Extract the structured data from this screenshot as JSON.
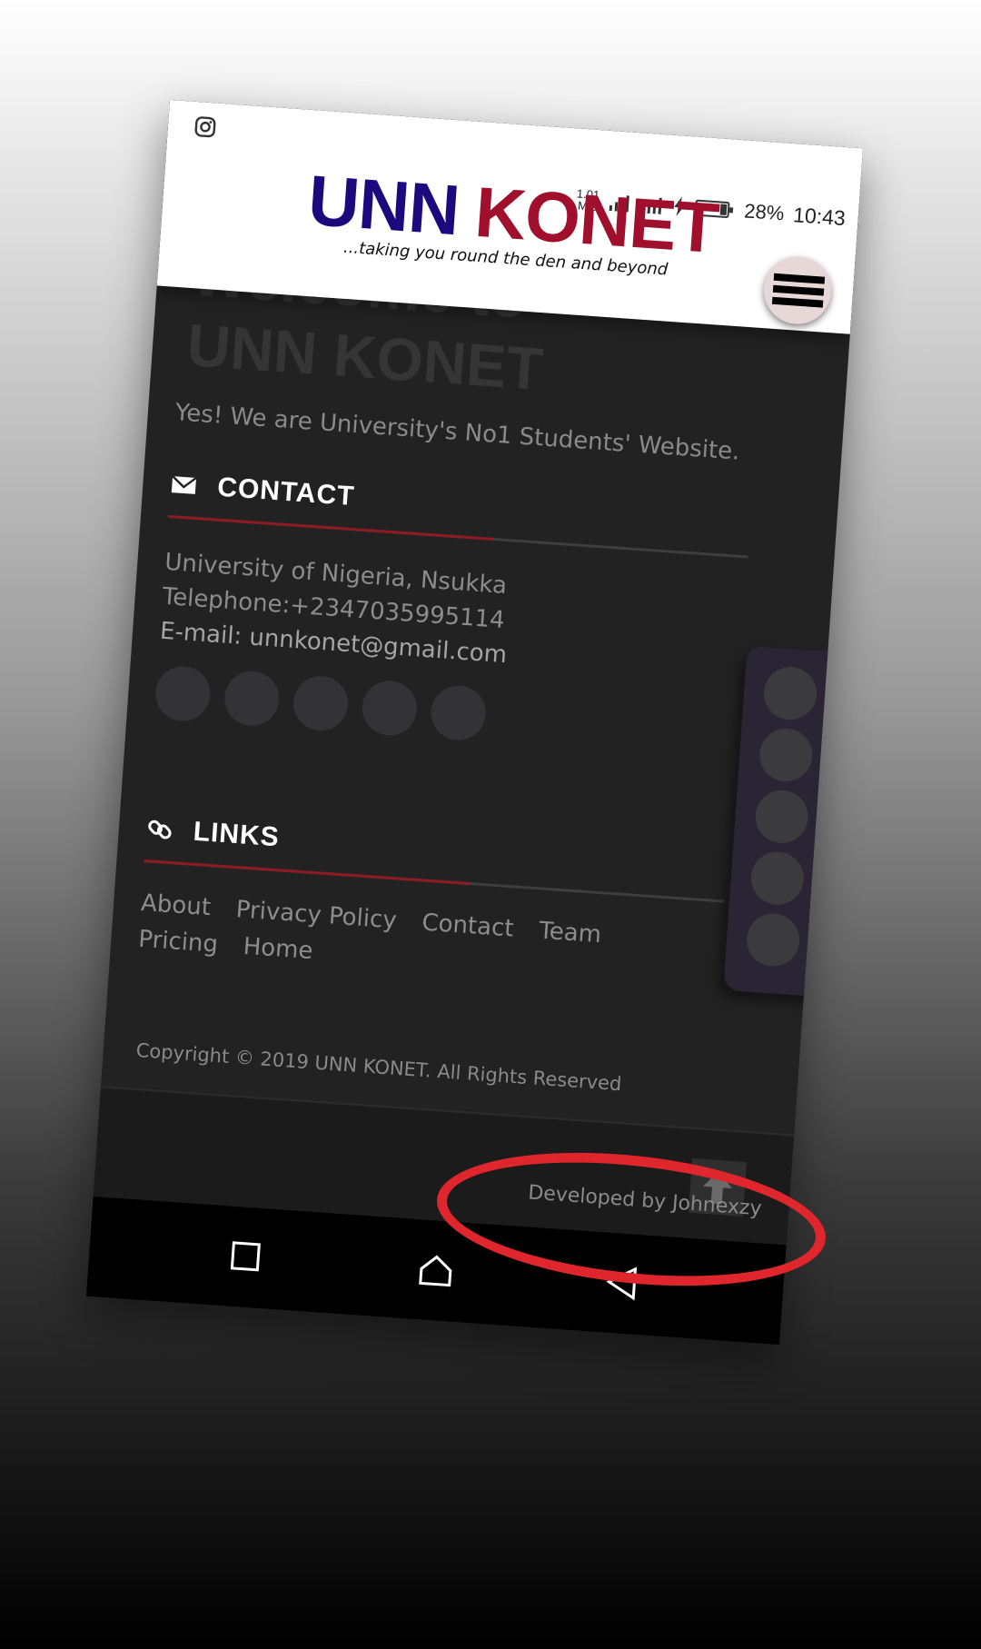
{
  "header": {
    "logo_part1": "UNN",
    "logo_part2": "KONET",
    "tagline": "...taking you round the den and beyond",
    "social_icon": "instagram-icon",
    "menu_icon": "hamburger-menu-icon"
  },
  "status_bar": {
    "speed_value": "1.01",
    "speed_unit": "M/s",
    "battery": "28%",
    "time": "10:43"
  },
  "hero": {
    "title_line1": "Welcome to",
    "title_line2": "UNN KONET",
    "subtitle": "Yes! We are University's No1 Students' Website."
  },
  "contact": {
    "heading": "CONTACT",
    "address": "University of Nigeria, Nsukka",
    "telephone": "Telephone:+2347035995114",
    "email": "E-mail: unnkonet@gmail.com"
  },
  "links": {
    "heading": "LINKS",
    "items": [
      "About",
      "Privacy Policy",
      "Contact",
      "Team",
      "Pricing",
      "Home"
    ]
  },
  "footer": {
    "copyright": "Copyright © 2019 UNN KONET. All Rights Reserved",
    "developer": "Developed by Johnexzy"
  },
  "colors": {
    "logo_blue": "#1a0a7d",
    "logo_red": "#a0102c",
    "page_dark": "#222223",
    "accent_red": "#8e1a22",
    "annotation_red": "#e0262d"
  }
}
